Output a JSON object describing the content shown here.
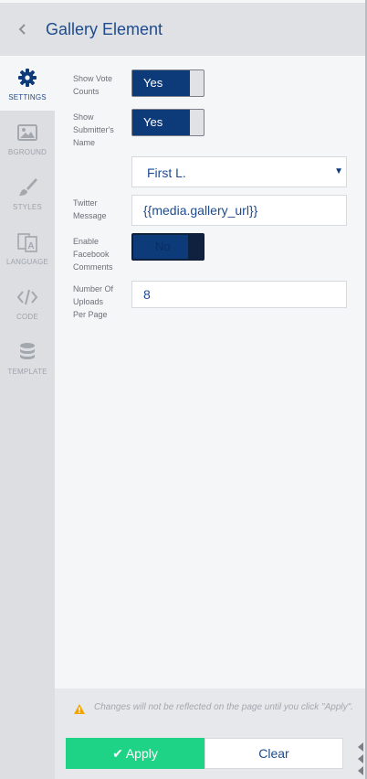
{
  "header": {
    "title": "Gallery Element"
  },
  "sidebar": {
    "items": [
      {
        "label": "SETTINGS",
        "icon": "gear-icon",
        "active": true
      },
      {
        "label": "BGROUND",
        "icon": "image-icon"
      },
      {
        "label": "STYLES",
        "icon": "brush-icon"
      },
      {
        "label": "LANGUAGE",
        "icon": "translate-icon"
      },
      {
        "label": "CODE",
        "icon": "code-icon"
      },
      {
        "label": "TEMPLATE",
        "icon": "database-icon"
      }
    ]
  },
  "settings": {
    "show_vote_counts": {
      "label_lines": [
        "Show Vote",
        "Counts"
      ],
      "value": "Yes"
    },
    "show_submitter_name": {
      "label_lines": [
        "Show",
        "Submitter's",
        "Name"
      ],
      "value": "Yes"
    },
    "name_format": {
      "selected": "First L."
    },
    "twitter_message": {
      "label_lines": [
        "Twitter",
        "Message"
      ],
      "value": "{{media.gallery_url}}"
    },
    "enable_facebook_comments": {
      "label_lines": [
        "Enable",
        "Facebook",
        "Comments"
      ],
      "value": "No"
    },
    "uploads_per_page": {
      "label_lines": [
        "Number Of",
        "Uploads",
        "Per Page"
      ],
      "value": "8"
    }
  },
  "footer": {
    "warning": "Changes will not be reflected on the page until you click \"Apply\".",
    "apply_label": "Apply",
    "clear_label": "Clear"
  },
  "colors": {
    "accent": "#0d3b7a",
    "title": "#1d4b8f",
    "apply": "#1fd386",
    "warning": "#f0a500"
  }
}
